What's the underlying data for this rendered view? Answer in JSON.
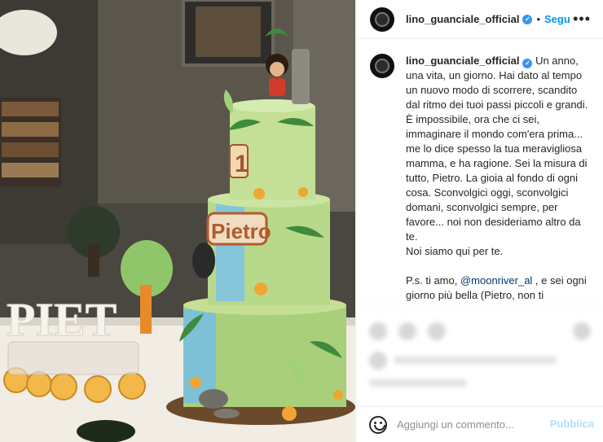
{
  "header": {
    "username": "lino_guanciale_official",
    "separator": "•",
    "follow_label": "Segu",
    "more_icon": "more-horizontal-icon"
  },
  "caption": {
    "username": "lino_guanciale_official",
    "text_part1": "Un anno, una vita, un giorno. Hai dato al tempo un nuovo modo di scorrere, scandito dal ritmo dei tuoi passi piccoli e grandi. È impossibile, ora che ci sei, immaginare il mondo com'era prima... me lo dice spesso la tua meravigliosa mamma, e ha ragione. Sei la misura di tutto, Pietro. La gioia al fondo di ogni cosa. Sconvolgici oggi, sconvolgici domani, sconvolgici sempre, per favore... noi non desideriamo altro da te.\nNoi siamo qui per te.\n\nP.s. ti amo, ",
    "mention": "@moonriver_al",
    "text_part2": " , e sei ogni giorno più bella (Pietro, non ti ingelosire, per favore! Questo post è"
  },
  "photo": {
    "cake_number": "1",
    "cake_name": "Pietro",
    "table_letters": "PIET"
  },
  "comment": {
    "placeholder": "Aggiungi un commento...",
    "publish_label": "Pubblica",
    "emoji_icon": "smiley-icon"
  },
  "colors": {
    "accent": "#0095f6",
    "publish_disabled": "#b2dffc",
    "verified": "#3897f0",
    "mention": "#00376b"
  }
}
